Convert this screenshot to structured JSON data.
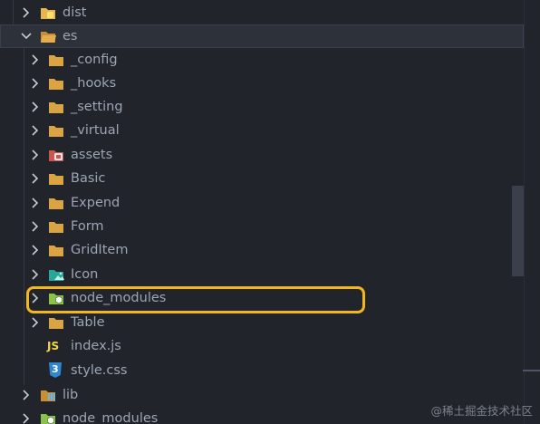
{
  "tree": {
    "rows": [
      {
        "label": "dist",
        "icon": "folder-dist-icon",
        "expanded": false
      },
      {
        "label": "es",
        "icon": "folder-open-icon",
        "expanded": true
      },
      {
        "label": "_config",
        "icon": "folder-icon",
        "expanded": false
      },
      {
        "label": "_hooks",
        "icon": "folder-icon",
        "expanded": false
      },
      {
        "label": "_setting",
        "icon": "folder-icon",
        "expanded": false
      },
      {
        "label": "_virtual",
        "icon": "folder-icon",
        "expanded": false
      },
      {
        "label": "assets",
        "icon": "folder-assets-icon",
        "expanded": false
      },
      {
        "label": "Basic",
        "icon": "folder-icon",
        "expanded": false
      },
      {
        "label": "Expend",
        "icon": "folder-icon",
        "expanded": false
      },
      {
        "label": "Form",
        "icon": "folder-icon",
        "expanded": false
      },
      {
        "label": "GridItem",
        "icon": "folder-icon",
        "expanded": false
      },
      {
        "label": "Icon",
        "icon": "folder-images-icon",
        "expanded": false
      },
      {
        "label": "node_modules",
        "icon": "folder-node-icon",
        "expanded": false
      },
      {
        "label": "Table",
        "icon": "folder-icon",
        "expanded": false
      },
      {
        "label": "index.js",
        "icon": "javascript-file-icon"
      },
      {
        "label": "style.css",
        "icon": "css-file-icon"
      },
      {
        "label": "lib",
        "icon": "folder-lib-icon",
        "expanded": false
      },
      {
        "label": "node_modules",
        "icon": "folder-node-icon",
        "expanded": false
      }
    ]
  },
  "icons": {
    "js_badge": "JS",
    "css_badge": "3"
  },
  "colors": {
    "folder": "#d9a441",
    "node_folder": "#8bc34a",
    "highlight": "#f2b71c",
    "text": "#9da5b4"
  },
  "watermark": "@稀土掘金技术社区"
}
